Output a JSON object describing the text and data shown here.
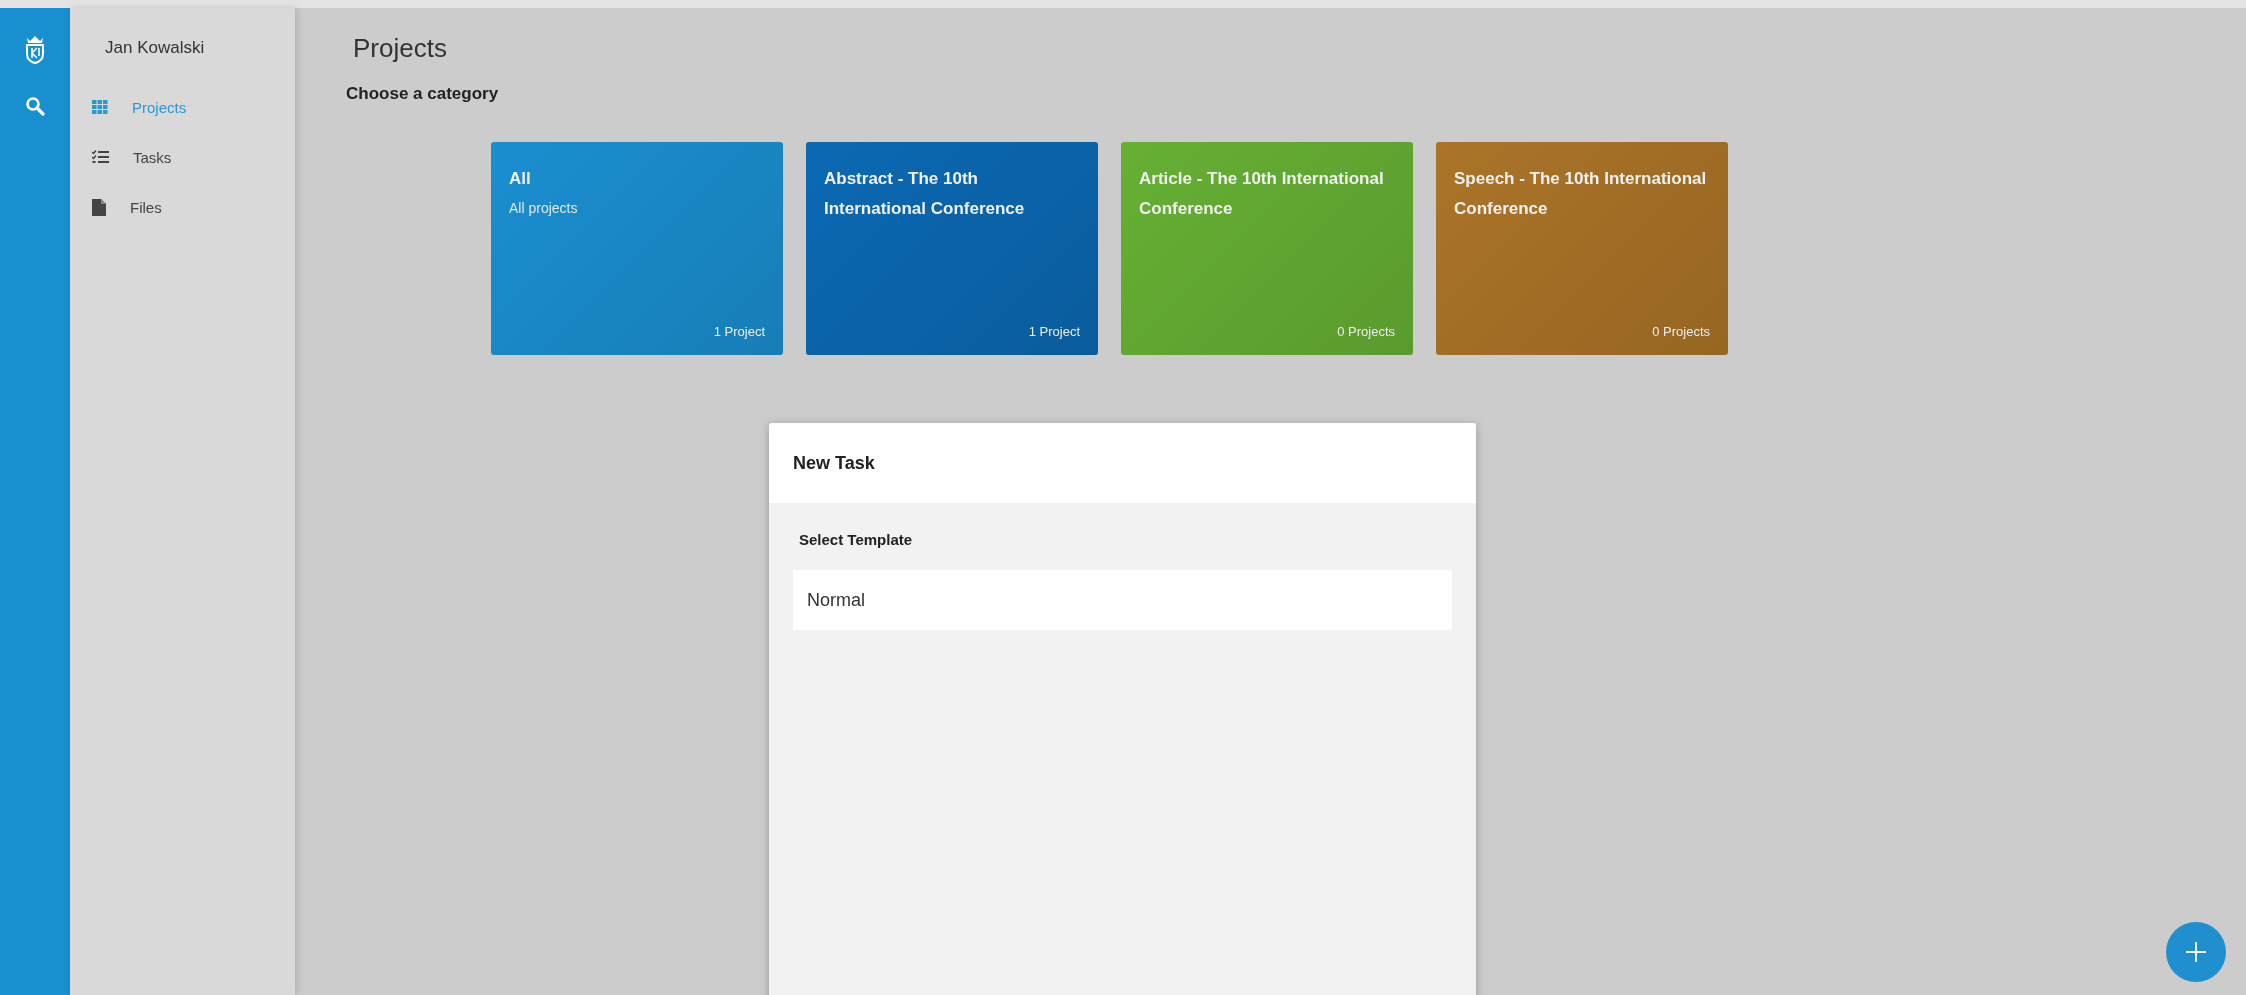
{
  "user": {
    "name": "Jan Kowalski"
  },
  "nav": [
    {
      "label": "Projects",
      "kind": "grid",
      "selected": true
    },
    {
      "label": "Tasks",
      "kind": "checklist",
      "selected": false
    },
    {
      "label": "Files",
      "kind": "file",
      "selected": false
    }
  ],
  "page": {
    "title": "Projects",
    "subtitle": "Choose a category"
  },
  "categories": [
    {
      "title": "All",
      "description": "All projects",
      "count": "1 Project",
      "color": "#1a8fd0"
    },
    {
      "title": "Abstract - The 10th International Conference",
      "count": "1 Project",
      "color": "#0b69b3"
    },
    {
      "title": "Article - The 10th International Conference",
      "count": "0 Projects",
      "color": "#66b034"
    },
    {
      "title": "Speech - The 10th International Conference",
      "count": "0 Projects",
      "color": "#ab7428"
    }
  ],
  "dialog": {
    "title": "New Task",
    "label": "Select Template",
    "templates": [
      "Normal"
    ]
  }
}
